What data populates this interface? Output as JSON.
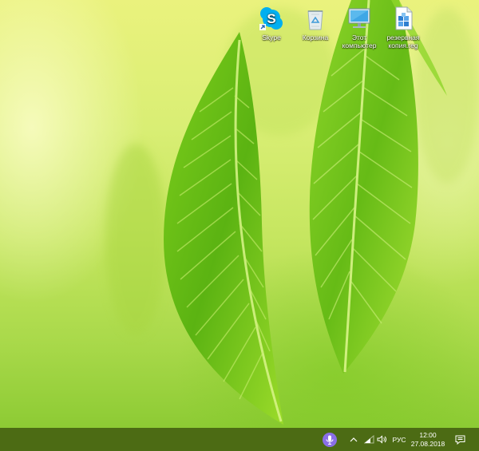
{
  "desktop": {
    "icons": [
      {
        "label": "Skype",
        "icon": "skype-icon"
      },
      {
        "label": "Корзина",
        "icon": "recycle-bin-icon"
      },
      {
        "label": "Этот\nкомпьютер",
        "icon": "this-pc-icon"
      },
      {
        "label": "резервная\nкопия.reg",
        "icon": "registry-file-icon"
      }
    ]
  },
  "taskbar": {
    "cortana": {
      "icon": "microphone-icon",
      "color": "#8a6fe6"
    },
    "tray": {
      "chevron_icon": "chevron-up-icon",
      "network_icon": "wifi-icon",
      "volume_icon": "speaker-icon",
      "language": "РУС",
      "time": "12:00",
      "date": "27.08.2018",
      "notifications_icon": "action-center-icon"
    },
    "color": "#4c6b14"
  }
}
